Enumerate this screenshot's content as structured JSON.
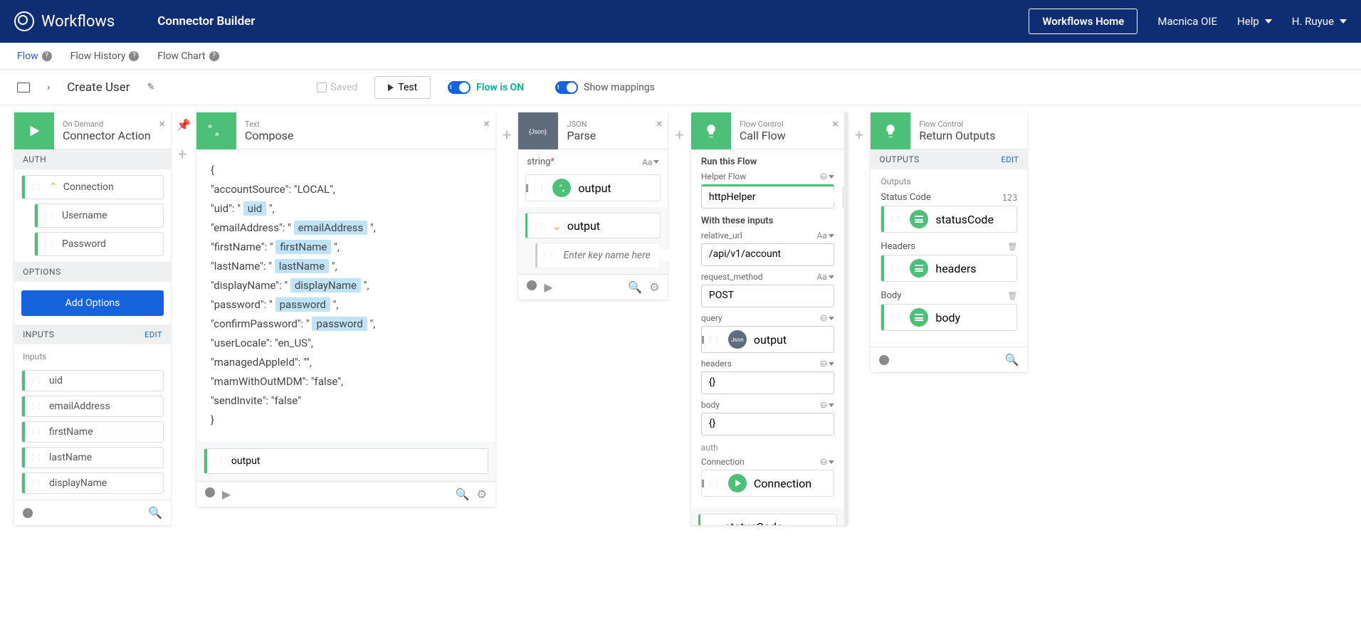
{
  "topnav": {
    "logo": "Workflows",
    "breadcrumb": "Connector Builder",
    "home_btn": "Workflows Home",
    "org": "Macnica OIE",
    "help": "Help",
    "user": "H. Ruyue"
  },
  "subnav": {
    "flow": "Flow",
    "history": "Flow History",
    "chart": "Flow Chart"
  },
  "toolbar": {
    "flow_name": "Create User",
    "saved": "Saved",
    "test": "Test",
    "flow_on": "Flow is ON",
    "mappings": "Show mappings"
  },
  "card1": {
    "subtitle": "On Demand",
    "title": "Connector Action",
    "auth_h": "AUTH",
    "connection": "Connection",
    "username": "Username",
    "password": "Password",
    "options_h": "OPTIONS",
    "add_options": "Add Options",
    "inputs_h": "INPUTS",
    "inputs_label": "Inputs",
    "edit": "EDIT",
    "fields": {
      "uid": "uid",
      "emailAddress": "emailAddress",
      "firstName": "firstName",
      "lastName": "lastName",
      "displayName": "displayName"
    }
  },
  "card2": {
    "subtitle": "Text",
    "title": "Compose",
    "lines": {
      "open": "{",
      "l1a": "\"accountSource\": \"LOCAL\",",
      "l2a": "\"uid\": \" ",
      "l2v": "uid",
      "l2b": " \",",
      "l3a": "\"emailAddress\": \" ",
      "l3v": "emailAddress",
      "l3b": " \",",
      "l4a": "\"firstName\": \" ",
      "l4v": "firstName",
      "l4b": " \",",
      "l5a": "\"lastName\": \" ",
      "l5v": "lastName",
      "l5b": " \",",
      "l6a": "\"displayName\": \" ",
      "l6v": "displayName",
      "l6b": " \",",
      "l7a": "\"password\": \" ",
      "l7v": "password",
      "l7b": " \",",
      "l8a": "\"confirmPassword\": \" ",
      "l8v": "password",
      "l8b": " \",",
      "l9": "\"userLocale\": \"en_US\",",
      "l10": "\"managedAppleId\": \"\",",
      "l11": "\"mamWithOutMDM\": \"false\",",
      "l12": "\"sendInvite\": \"false\"",
      "close": "}"
    },
    "output": "output"
  },
  "card3": {
    "subtitle": "JSON",
    "title": "Parse",
    "string_label": "string",
    "type_aa": "Aa",
    "input_val": "output",
    "output": "output",
    "key_placeholder": "Enter key name here"
  },
  "card4": {
    "subtitle": "Flow Control",
    "title": "Call Flow",
    "run_label": "Run this Flow",
    "helper_label": "Helper Flow",
    "helper_val": "httpHelper",
    "inputs_label": "With these inputs",
    "rel_url_label": "relative_url",
    "rel_url_val": "/api/v1/account",
    "method_label": "request_method",
    "method_val": "POST",
    "query_label": "query",
    "query_val": "output",
    "headers_label": "headers",
    "headers_val": "{}",
    "body_label": "body",
    "body_val": "{}",
    "auth_label": "auth",
    "conn_label": "Connection",
    "conn_val": "Connection",
    "status_out": "statusCode",
    "type_aa": "Aa"
  },
  "card5": {
    "subtitle": "Flow Control",
    "title": "Return Outputs",
    "outputs_h": "OUTPUTS",
    "edit": "EDIT",
    "outputs_label": "Outputs",
    "status_label": "Status Code",
    "status_num": "123",
    "status_val": "statusCode",
    "headers_label": "Headers",
    "headers_val": "headers",
    "body_label": "Body",
    "body_val": "body"
  }
}
